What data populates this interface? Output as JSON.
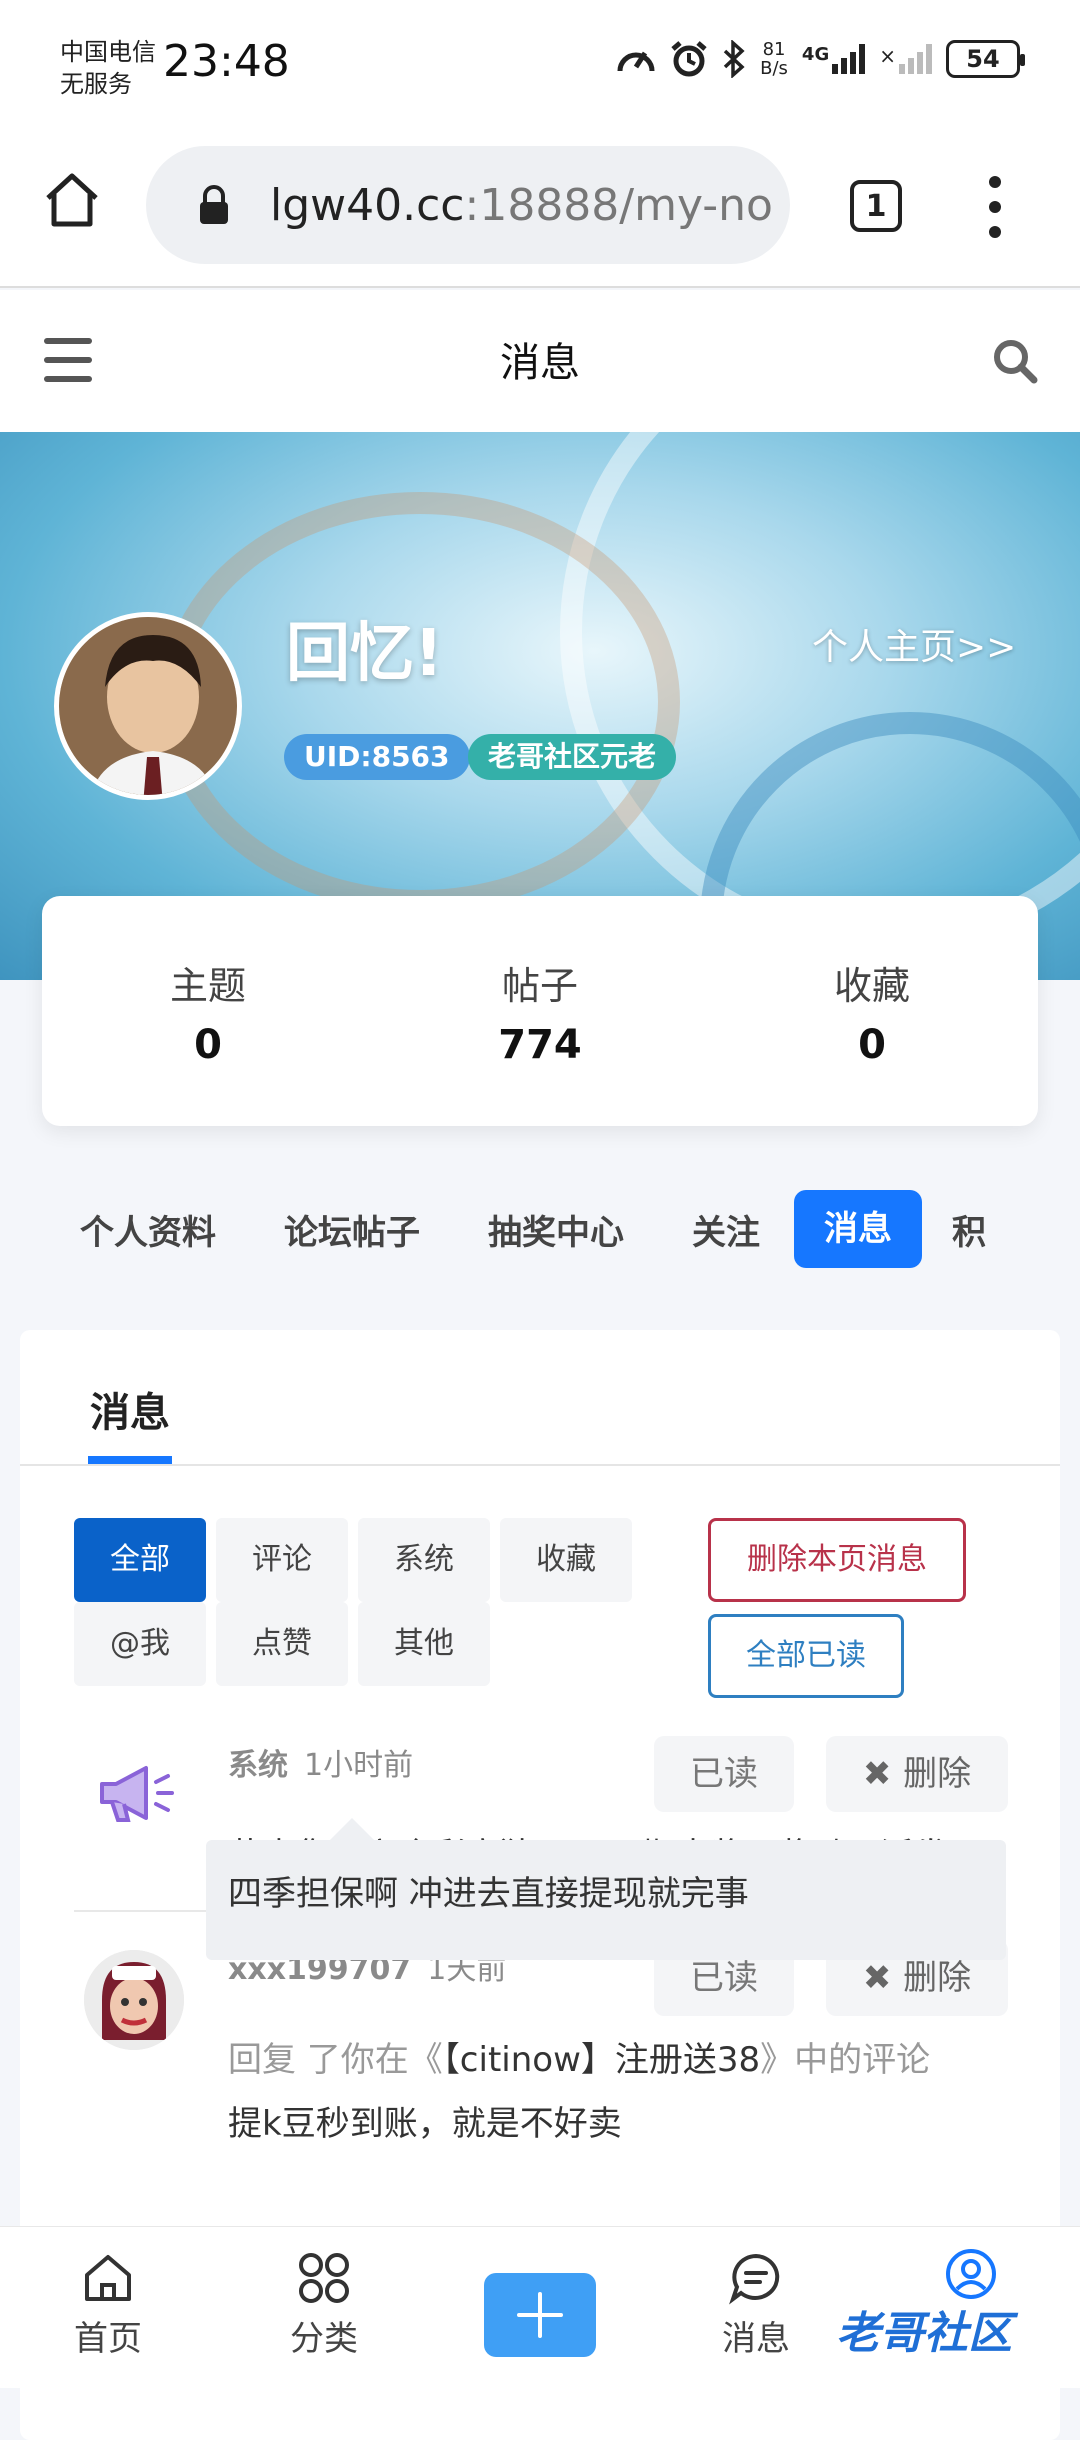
{
  "status_bar": {
    "carrier_line1": "中国电信",
    "carrier_line2": "无服务",
    "time": "23:48",
    "net_speed_value": "81",
    "net_speed_unit": "B/s",
    "network": "4G",
    "battery": "54"
  },
  "browser": {
    "url_host": "lgw40.cc",
    "url_rest": ":18888/my-no",
    "tab_count": "1"
  },
  "header": {
    "title": "消息"
  },
  "profile": {
    "username": "回忆!",
    "homepage_link": "个人主页>>",
    "uid": "UID:8563",
    "rank": "老哥社区元老",
    "stats": [
      {
        "label": "主题",
        "value": "0"
      },
      {
        "label": "帖子",
        "value": "774"
      },
      {
        "label": "收藏",
        "value": "0"
      }
    ]
  },
  "profile_tabs": [
    "个人资料",
    "论坛帖子",
    "抽奖中心",
    "关注",
    "消息",
    "积"
  ],
  "messages": {
    "card_title": "消息",
    "filters": [
      "全部",
      "评论",
      "系统",
      "收藏",
      "@我",
      "点赞",
      "其他"
    ],
    "delete_page": "删除本页消息",
    "mark_all_read": "全部已读",
    "read_label": "已读",
    "delete_label": "删除",
    "items": [
      {
        "sender": "系统",
        "time": "1小时前",
        "text": "恭喜您在六合彩竞猜26009期中奖，奖励已派发"
      },
      {
        "sender": "xxx199707",
        "time": "1天前",
        "reply_prefix": "回复 了你在《",
        "reply_topic": "【citinow】注册送38",
        "reply_suffix": "》中的评论",
        "text": "提k豆秒到账，就是不好卖",
        "quote": "四季担保啊 冲进去直接提现就完事"
      }
    ]
  },
  "bottom_nav": {
    "home": "首页",
    "category": "分类",
    "messages": "消息",
    "logo": "老哥社区"
  },
  "colors": {
    "accent": "#1677ff",
    "active_filter": "#0a62c9",
    "delete_border": "#b8324a",
    "mark_all_border": "#2e7fc1"
  }
}
